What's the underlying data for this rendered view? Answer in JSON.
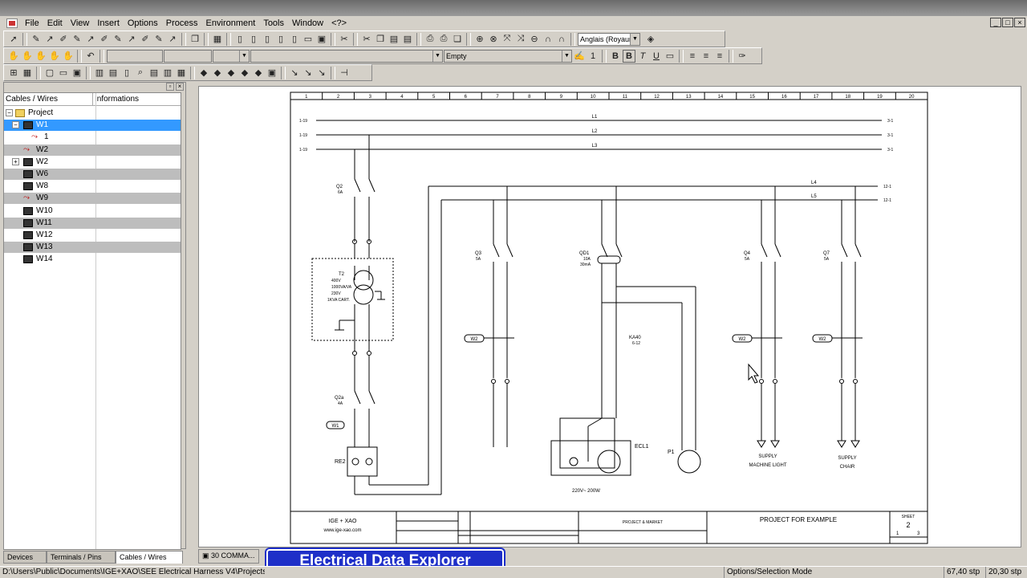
{
  "app": {
    "title": "SEE Electrical Harness V4"
  },
  "menu": {
    "items": [
      {
        "label": "File",
        "name": "menu-file"
      },
      {
        "label": "Edit",
        "name": "menu-edit"
      },
      {
        "label": "View",
        "name": "menu-view"
      },
      {
        "label": "Insert",
        "name": "menu-insert"
      },
      {
        "label": "Options",
        "name": "menu-options"
      },
      {
        "label": "Process",
        "name": "menu-process"
      },
      {
        "label": "Environment",
        "name": "menu-environment"
      },
      {
        "label": "Tools",
        "name": "menu-tools"
      },
      {
        "label": "Window",
        "name": "menu-window"
      },
      {
        "label": "<?>",
        "name": "menu-help"
      }
    ]
  },
  "toolbar": {
    "language": "Anglais (Royaum",
    "style_combo": "Empty",
    "font_size": "1"
  },
  "panel": {
    "columns": [
      "Cables / Wires",
      "Informations"
    ],
    "tree": [
      {
        "label": "Project",
        "icon": "folder-icon",
        "state": "normal"
      },
      {
        "label": "W1",
        "icon": "cable-icon",
        "state": "active"
      },
      {
        "label": "1",
        "icon": "wire-icon",
        "state": "normal"
      },
      {
        "label": "W2",
        "icon": "wire-icon",
        "state": "selected"
      },
      {
        "label": "W2",
        "icon": "cable-icon",
        "state": "normal"
      },
      {
        "label": "W6",
        "icon": "cable-icon",
        "state": "selected"
      },
      {
        "label": "W8",
        "icon": "cable-icon",
        "state": "normal"
      },
      {
        "label": "W9",
        "icon": "wire-icon",
        "state": "selected"
      },
      {
        "label": "W10",
        "icon": "cable-icon",
        "state": "normal"
      },
      {
        "label": "W11",
        "icon": "cable-icon",
        "state": "selected"
      },
      {
        "label": "W12",
        "icon": "cable-icon",
        "state": "normal"
      },
      {
        "label": "W13",
        "icon": "cable-icon",
        "state": "selected"
      },
      {
        "label": "W14",
        "icon": "cable-icon",
        "state": "normal"
      }
    ],
    "tabs": [
      "Devices",
      "Terminals / Pins",
      "Cables / Wires"
    ]
  },
  "document_tabs": [
    "30 COMMA..."
  ],
  "watermark": "Electrical Data Explorer",
  "status": {
    "path": "D:\\Users\\Public\\Documents\\IGE+XAO\\SEE Electrical Harness V4\\Projects\\A",
    "mode": "Options/Selection Mode",
    "x": "67,40 stp",
    "y": "20,30 stp"
  },
  "drawing": {
    "columns": [
      "1",
      "2",
      "3",
      "4",
      "5",
      "6",
      "7",
      "8",
      "9",
      "10",
      "11",
      "12",
      "13",
      "14",
      "15",
      "16",
      "17",
      "18",
      "19",
      "20"
    ],
    "lines": [
      {
        "label": "L1",
        "left": "1-19",
        "right": "3-1"
      },
      {
        "label": "L2",
        "left": "1-19",
        "right": "3-1"
      },
      {
        "label": "L3",
        "left": "1-19",
        "right": "3-1"
      },
      {
        "label": "L4",
        "right": "12-1"
      },
      {
        "label": "L5",
        "right": "12-1"
      }
    ],
    "devices": {
      "q2": "Q2",
      "q2_rating": "6A",
      "t2": "T2",
      "t2_specs": [
        "400V",
        "1000VA/VA",
        "230V",
        "1KVA CART."
      ],
      "q2a": "Q2a",
      "q2a_rating": "4A",
      "re2": "RE2",
      "q3": "Q3",
      "q3_rating": "5A",
      "qd1": "QD1",
      "qd1_rating": [
        "10A",
        "30mA"
      ],
      "ka40": "KA40",
      "ka40_ref": "6-12",
      "ecl1": "ECL1",
      "ecl1_power": "220V~ 200W",
      "p1": "P1",
      "q4": "Q4",
      "q4_rating": "5A",
      "q7": "Q7",
      "q7_rating": "5A",
      "supply1": [
        "SUPPLY",
        "MACHINE LIGHT"
      ],
      "supply2": [
        "SUPPLY",
        "CHAIR"
      ]
    },
    "wires": [
      "W1",
      "W2",
      "W2",
      "W2"
    ],
    "titleblock": {
      "company": "IGE + XAO",
      "url": "www.ige-xao.com",
      "project": "PROJECT & MARKET",
      "title": "PROJECT FOR EXAMPLE",
      "sheet_label": "SHEET",
      "sheet": "2",
      "prev": "1",
      "next": "3"
    }
  }
}
